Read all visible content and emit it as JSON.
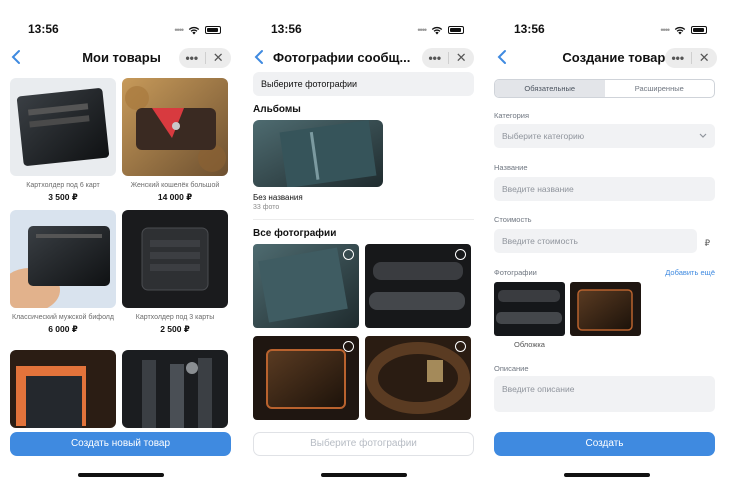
{
  "status": {
    "time": "13:56"
  },
  "screen1": {
    "title": "Мои товары",
    "products": [
      {
        "name": "Картхолдер под 6 карт",
        "price": "3 500 ₽"
      },
      {
        "name": "Женский кошелёк большой",
        "price": "14 000 ₽"
      },
      {
        "name": "Классический мужской бифолд",
        "price": "6 000 ₽"
      },
      {
        "name": "Картхолдер под 3 карты",
        "price": "2 500 ₽"
      },
      {
        "name": "",
        "price": ""
      },
      {
        "name": "",
        "price": ""
      }
    ],
    "create_button": "Создать новый товар"
  },
  "screen2": {
    "title": "Фотографии сообщ...",
    "select_label": "Выберите фотографии",
    "albums_title": "Альбомы",
    "album": {
      "name": "Без названия",
      "count": "33 фото"
    },
    "all_photos_title": "Все фотографии",
    "bottom_button": "Выберите фотографии"
  },
  "screen3": {
    "title": "Создание товара",
    "tabs": [
      "Обязательные",
      "Расширенные"
    ],
    "category_label": "Категория",
    "category_placeholder": "Выберите категорию",
    "name_label": "Название",
    "name_placeholder": "Введите название",
    "price_label": "Стоимость",
    "price_placeholder": "Введите стоимость",
    "currency": "₽",
    "photos_label": "Фотографии",
    "add_more": "Добавить ещё",
    "cover_label": "Обложка",
    "description_label": "Описание",
    "description_placeholder": "Введите описание",
    "create_button": "Создать"
  },
  "capsule": {
    "more": "•••",
    "close": "✕"
  },
  "colors": {
    "accent": "#3f8ae0",
    "field_bg": "#f1f2f4"
  }
}
